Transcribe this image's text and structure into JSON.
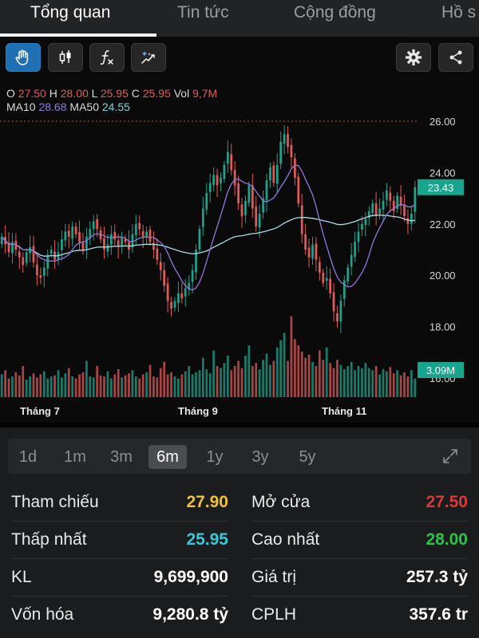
{
  "tabs": [
    {
      "label": "Tổng quan",
      "active": true
    },
    {
      "label": "Tin tức",
      "active": false
    },
    {
      "label": "Cộng đồng",
      "active": false
    },
    {
      "label": "Hồ s",
      "active": false
    }
  ],
  "toolbar": {
    "tools": [
      "hand-icon",
      "candlestick-icon",
      "function-icon",
      "magic-draw-icon"
    ],
    "right": [
      "gear-icon",
      "share-icon"
    ]
  },
  "ohlc": {
    "o_label": "O",
    "o": "27.50",
    "h_label": "H",
    "h": "28.00",
    "l_label": "L",
    "l": "25.95",
    "c_label": "C",
    "c": "25.95",
    "vol_label": "Vol",
    "vol": "9,7M"
  },
  "ma": {
    "ma10_label": "MA10",
    "ma10": "28.68",
    "ma50_label": "MA50",
    "ma50": "24.55"
  },
  "colors": {
    "up": "#21a08a",
    "down": "#e05a5a",
    "ma10": "#8f7ad9",
    "ma50": "#a9dbe4",
    "badge": "#17a58d"
  },
  "chart_data": {
    "type": "candlestick",
    "x_labels": [
      "Tháng 7",
      "Tháng 9",
      "Tháng 11"
    ],
    "y_ticks": [
      "26.00",
      "24.00",
      "22.00",
      "20.00",
      "18.00",
      "16.00"
    ],
    "ylim": [
      16,
      26
    ],
    "reference_line": 26.0,
    "last_price_label": "23.43",
    "last_volume_label": "3.09M",
    "closes": [
      21.5,
      21.2,
      20.9,
      21.3,
      21.0,
      20.7,
      20.4,
      20.9,
      21.1,
      20.5,
      20.0,
      19.9,
      20.3,
      20.8,
      21.0,
      20.6,
      20.9,
      21.4,
      21.7,
      21.5,
      21.9,
      21.6,
      21.3,
      21.0,
      21.5,
      21.8,
      22.1,
      21.8,
      21.4,
      21.0,
      21.2,
      21.6,
      21.4,
      21.1,
      21.5,
      21.3,
      21.0,
      21.6,
      22.0,
      21.8,
      21.5,
      21.7,
      21.3,
      21.0,
      20.6,
      20.2,
      19.6,
      19.0,
      18.7,
      19.0,
      19.3,
      19.1,
      19.5,
      19.7,
      20.2,
      21.0,
      21.8,
      22.6,
      23.2,
      23.6,
      23.9,
      23.5,
      23.8,
      24.3,
      24.8,
      24.1,
      23.5,
      22.8,
      22.3,
      22.9,
      23.5,
      22.6,
      21.9,
      22.4,
      23.0,
      23.7,
      24.2,
      23.6,
      24.3,
      25.2,
      25.5,
      25.0,
      24.6,
      23.8,
      22.8,
      21.6,
      21.0,
      20.7,
      21.2,
      20.6,
      20.1,
      19.7,
      19.9,
      19.3,
      18.6,
      18.2,
      19.0,
      19.8,
      20.3,
      20.8,
      21.3,
      21.7,
      22.0,
      22.2,
      22.5,
      22.8,
      22.3,
      22.6,
      22.9,
      23.3,
      22.9,
      22.5,
      23.1,
      22.7,
      22.3,
      22.0,
      22.4,
      23.43
    ],
    "volume_levels": [
      0.22,
      0.26,
      0.18,
      0.2,
      0.24,
      0.21,
      0.3,
      0.17,
      0.2,
      0.23,
      0.19,
      0.22,
      0.25,
      0.18,
      0.2,
      0.21,
      0.26,
      0.19,
      0.23,
      0.28,
      0.2,
      0.18,
      0.22,
      0.24,
      0.35,
      0.2,
      0.19,
      0.3,
      0.21,
      0.2,
      0.25,
      0.18,
      0.22,
      0.27,
      0.19,
      0.21,
      0.23,
      0.26,
      0.2,
      0.18,
      0.22,
      0.24,
      0.31,
      0.2,
      0.19,
      0.28,
      0.34,
      0.22,
      0.24,
      0.2,
      0.18,
      0.22,
      0.25,
      0.3,
      0.22,
      0.24,
      0.26,
      0.38,
      0.27,
      0.23,
      0.45,
      0.3,
      0.28,
      0.33,
      0.4,
      0.26,
      0.3,
      0.35,
      0.28,
      0.4,
      0.5,
      0.3,
      0.33,
      0.27,
      0.36,
      0.42,
      0.31,
      0.35,
      0.48,
      0.55,
      0.62,
      0.35,
      0.78,
      0.56,
      0.5,
      0.44,
      0.38,
      0.41,
      0.34,
      0.3,
      0.45,
      0.36,
      0.48,
      0.33,
      0.28,
      0.36,
      0.31,
      0.27,
      0.3,
      0.34,
      0.26,
      0.3,
      0.28,
      0.33,
      0.28,
      0.26,
      0.3,
      0.22,
      0.27,
      0.25,
      0.29,
      0.23,
      0.26,
      0.21,
      0.24,
      0.2,
      0.26,
      0.18
    ]
  },
  "periods": [
    {
      "label": "1d",
      "active": false
    },
    {
      "label": "1m",
      "active": false
    },
    {
      "label": "3m",
      "active": false
    },
    {
      "label": "6m",
      "active": true
    },
    {
      "label": "1y",
      "active": false
    },
    {
      "label": "3y",
      "active": false
    },
    {
      "label": "5y",
      "active": false
    }
  ],
  "stats": {
    "ref_label": "Tham chiếu",
    "ref": "27.90",
    "open_label": "Mở cửa",
    "open": "27.50",
    "low_label": "Thấp nhất",
    "low": "25.95",
    "high_label": "Cao nhất",
    "high": "28.00",
    "vol_label": "KL",
    "vol": "9,699,900",
    "value_label": "Giá trị",
    "value": "257.3 tỷ",
    "cap_label": "Vốn hóa",
    "cap": "9,280.8 tỷ",
    "shares_label": "CPLH",
    "shares": "357.6 tr"
  },
  "stat_colors": {
    "ref": "#f0c23c",
    "open": "#d83a3a",
    "low": "#39c8d8",
    "high": "#2ec24a",
    "neutral": "#ffffff"
  }
}
